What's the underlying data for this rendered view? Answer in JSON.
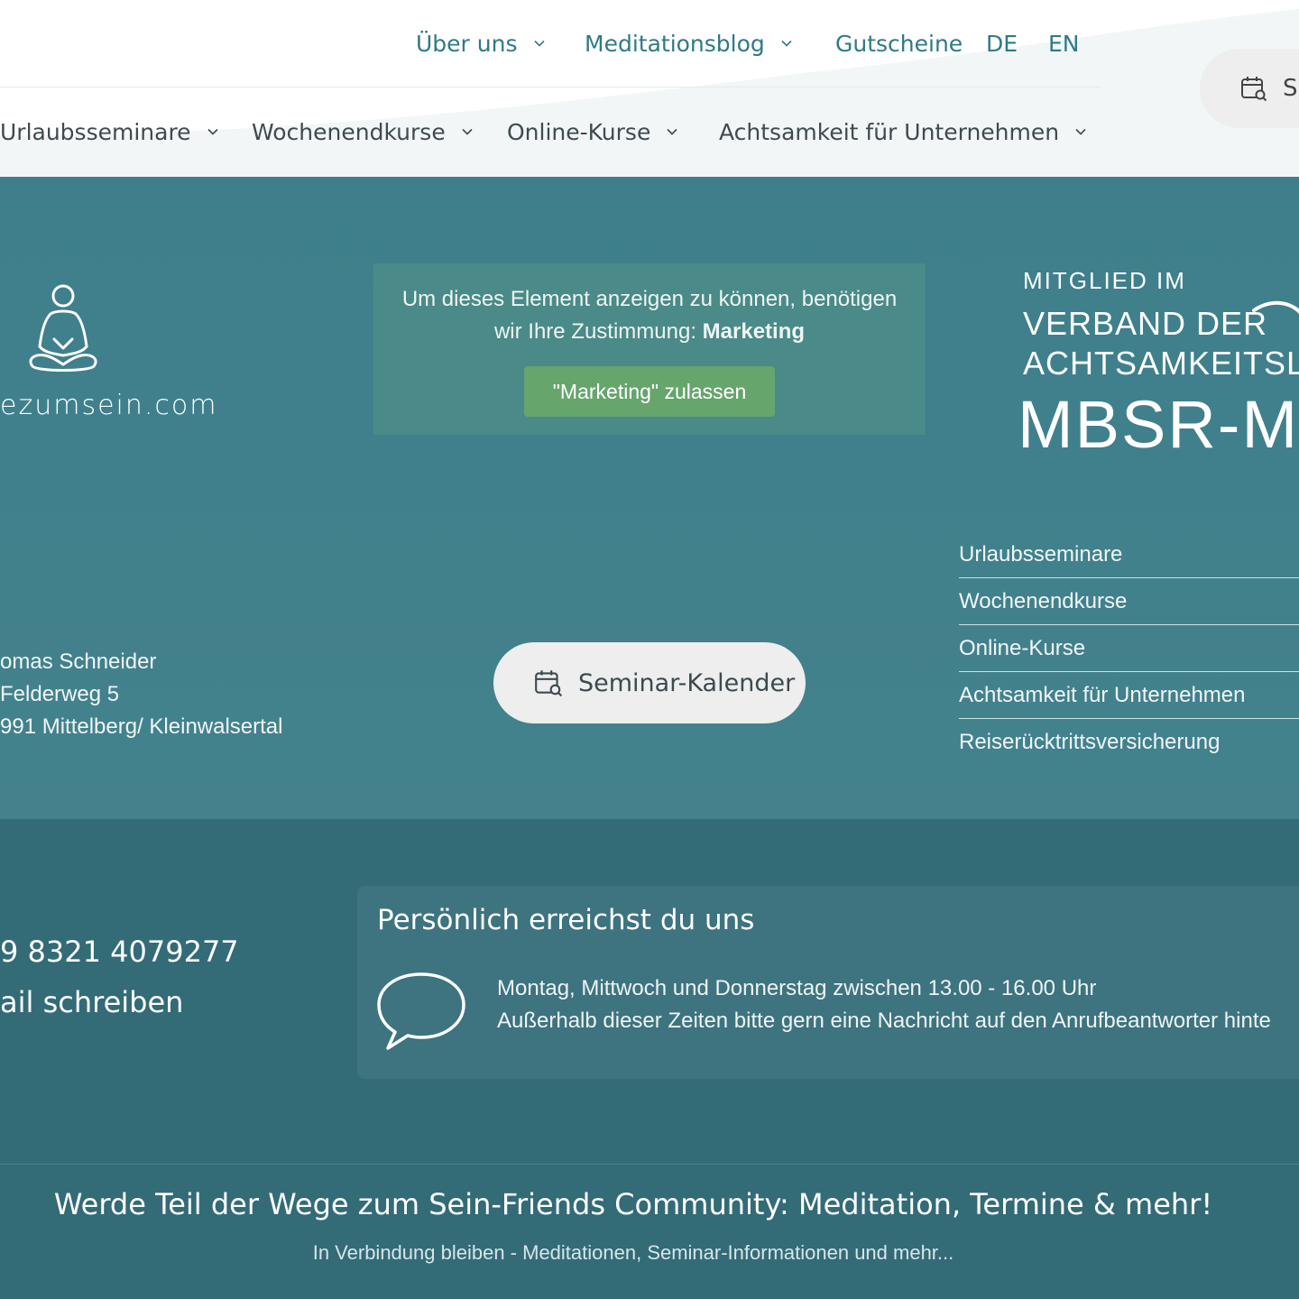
{
  "header": {
    "top_nav": [
      {
        "label": "Über uns",
        "has_dropdown": true
      },
      {
        "label": "Meditationsblog",
        "has_dropdown": true
      },
      {
        "label": "Gutscheine",
        "has_dropdown": false
      },
      {
        "label": "DE",
        "has_dropdown": false
      },
      {
        "label": "EN",
        "has_dropdown": false
      }
    ],
    "main_nav": [
      {
        "label": "Urlaubsseminare"
      },
      {
        "label": "Wochenendkurse"
      },
      {
        "label": "Online-Kurse"
      },
      {
        "label": "Achtsamkeit für Unternehmen"
      }
    ],
    "calendar_pill_label": "S"
  },
  "footer": {
    "logo_text": "ezumsein.com",
    "consent": {
      "line1": "Um dieses Element anzeigen zu können, benötigen",
      "line2_prefix": "wir Ihre Zustimmung: ",
      "line2_bold": "Marketing",
      "button": "\"Marketing\" zulassen"
    },
    "membership": {
      "line1": "MITGLIED IM",
      "line2": "VERBAND DER",
      "line3": "ACHTSAMKEITSLE",
      "line4": "MBSR-M"
    },
    "address": [
      "omas Schneider",
      " Felderweg 5",
      "991 Mittelberg/ Kleinwalsertal"
    ],
    "calendar_button": "Seminar-Kalender",
    "side_links": [
      "Urlaubsseminare",
      "Wochenendkurse",
      "Online-Kurse",
      "Achtsamkeit für Unternehmen",
      "Reiserücktrittsversicherung"
    ],
    "phone": "9 8321 4079277",
    "mail": "ail schreiben",
    "contact": {
      "title": "Persönlich erreichst du uns",
      "line1": "Montag, Mittwoch und Donnerstag zwischen 13.00 - 16.00 Uhr",
      "line2": "Außerhalb dieser Zeiten bitte gern eine Nachricht auf den Anrufbeantworter hinte"
    },
    "community": {
      "title": "Werde Teil der Wege zum Sein-Friends Community: Meditation, Termine & mehr!",
      "subtitle": "In Verbindung bleiben - Meditationen, Seminar-Informationen und mehr..."
    }
  },
  "colors": {
    "header_bg": "#ffffff",
    "nav_teal": "#2f7a86",
    "footer_upper_bg": "#3e7f8b",
    "footer_lower_bg": "#336b77",
    "consent_button": "#66a56c"
  }
}
